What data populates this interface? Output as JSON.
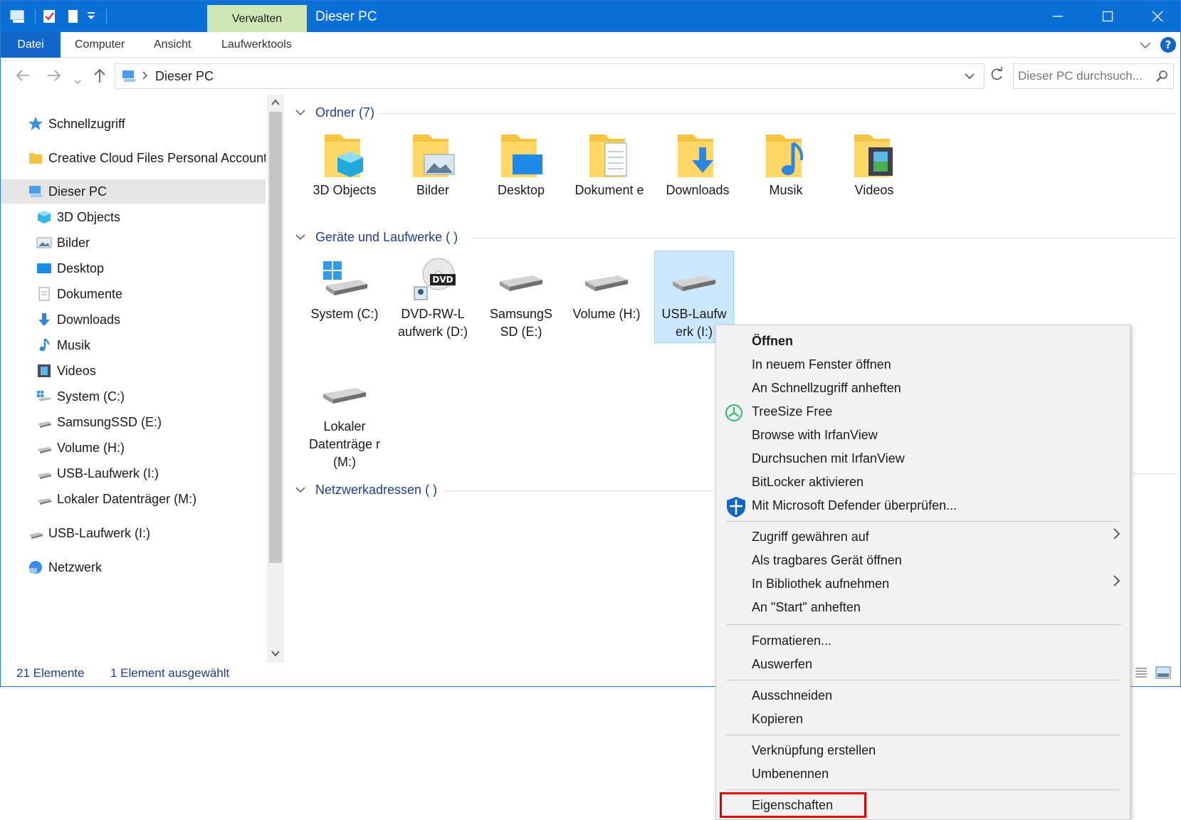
{
  "window": {
    "title": "Dieser PC",
    "contextual_tab": "Verwalten"
  },
  "ribbon": {
    "tabs": [
      "Datei",
      "Computer",
      "Ansicht",
      "Laufwerktools"
    ]
  },
  "address": {
    "path": "Dieser PC",
    "search_placeholder": "Dieser PC durchsuch..."
  },
  "sidebar": {
    "items": [
      {
        "label": "Schnellzugriff",
        "icon": "star-icon",
        "level": 0
      },
      {
        "label": "Creative Cloud Files Personal Account a",
        "icon": "folder-icon",
        "level": 0
      },
      {
        "label": "Dieser PC",
        "icon": "computer-icon",
        "level": 0,
        "selected": true
      },
      {
        "label": "3D Objects",
        "icon": "cube-icon",
        "level": 1
      },
      {
        "label": "Bilder",
        "icon": "pictures-icon",
        "level": 1
      },
      {
        "label": "Desktop",
        "icon": "desktop-icon",
        "level": 1
      },
      {
        "label": "Dokumente",
        "icon": "document-icon",
        "level": 1
      },
      {
        "label": "Downloads",
        "icon": "download-arrow-icon",
        "level": 1
      },
      {
        "label": "Musik",
        "icon": "music-note-icon",
        "level": 1
      },
      {
        "label": "Videos",
        "icon": "film-icon",
        "level": 1
      },
      {
        "label": "System (C:)",
        "icon": "system-drive-icon",
        "level": 1
      },
      {
        "label": "SamsungSSD (E:)",
        "icon": "drive-icon",
        "level": 1
      },
      {
        "label": "Volume (H:)",
        "icon": "drive-icon",
        "level": 1
      },
      {
        "label": "USB-Laufwerk (I:)",
        "icon": "drive-icon",
        "level": 1
      },
      {
        "label": "Lokaler Datenträger (M:)",
        "icon": "drive-icon",
        "level": 1
      },
      {
        "label": "USB-Laufwerk (I:)",
        "icon": "drive-icon",
        "level": 0
      },
      {
        "label": "Netzwerk",
        "icon": "network-icon",
        "level": 0
      }
    ]
  },
  "groups": {
    "folders": "Ordner (7)",
    "devices": "Geräte und Laufwerke (   )",
    "network": "Netzwerkadressen ( )"
  },
  "folders": [
    {
      "label": "3D Objects",
      "icon": "cube-icon"
    },
    {
      "label": "Bilder",
      "icon": "pictures-icon"
    },
    {
      "label": "Desktop",
      "icon": "desktop-icon"
    },
    {
      "label": "Dokument e",
      "icon": "document-icon"
    },
    {
      "label": "Downloads",
      "icon": "download-arrow-icon"
    },
    {
      "label": "Musik",
      "icon": "music-note-icon"
    },
    {
      "label": "Videos",
      "icon": "film-icon"
    }
  ],
  "drives": [
    {
      "label": "System (C:)",
      "icon": "system-drive-icon"
    },
    {
      "label": "DVD-RW-L aufwerk (D:)",
      "icon": "dvd-drive-icon",
      "badge": "DVD"
    },
    {
      "label": "SamsungS SD (E:)",
      "icon": "drive-icon"
    },
    {
      "label": "Volume (H:)",
      "icon": "drive-icon"
    },
    {
      "label": "USB-Laufw erk (I:)",
      "icon": "drive-icon",
      "selected": true
    },
    {
      "label": "Lokaler Datenträge r (M:)",
      "icon": "drive-icon"
    }
  ],
  "status": {
    "count": "21 Elemente",
    "selection": "1 Element ausgewählt"
  },
  "context_menu": {
    "items": [
      {
        "label": "Öffnen",
        "bold": true
      },
      {
        "label": "In neuem Fenster öffnen"
      },
      {
        "label": "An Schnellzugriff anheften"
      },
      {
        "label": "TreeSize Free",
        "icon": "treesize-icon"
      },
      {
        "label": "Browse with IrfanView"
      },
      {
        "label": "Durchsuchen mit IrfanView"
      },
      {
        "label": "BitLocker aktivieren"
      },
      {
        "label": "Mit Microsoft Defender überprüfen...",
        "icon": "defender-shield-icon"
      },
      {
        "label": "Zugriff gewähren auf",
        "submenu": true
      },
      {
        "label": "Als tragbares Gerät öffnen"
      },
      {
        "label": "In Bibliothek aufnehmen",
        "submenu": true
      },
      {
        "label": "An \"Start\" anheften"
      },
      {
        "label": "Formatieren..."
      },
      {
        "label": "Auswerfen"
      },
      {
        "label": "Ausschneiden"
      },
      {
        "label": "Kopieren"
      },
      {
        "label": "Verknüpfung erstellen"
      },
      {
        "label": "Umbenennen"
      },
      {
        "label": "Eigenschaften",
        "highlighted": true
      }
    ]
  },
  "colors": {
    "titlebar": "#0a6fd6",
    "verwalten": "#cde8b5",
    "selection": "#cce8ff",
    "highlight_box": "#e00000",
    "folder": "#f5c342"
  }
}
